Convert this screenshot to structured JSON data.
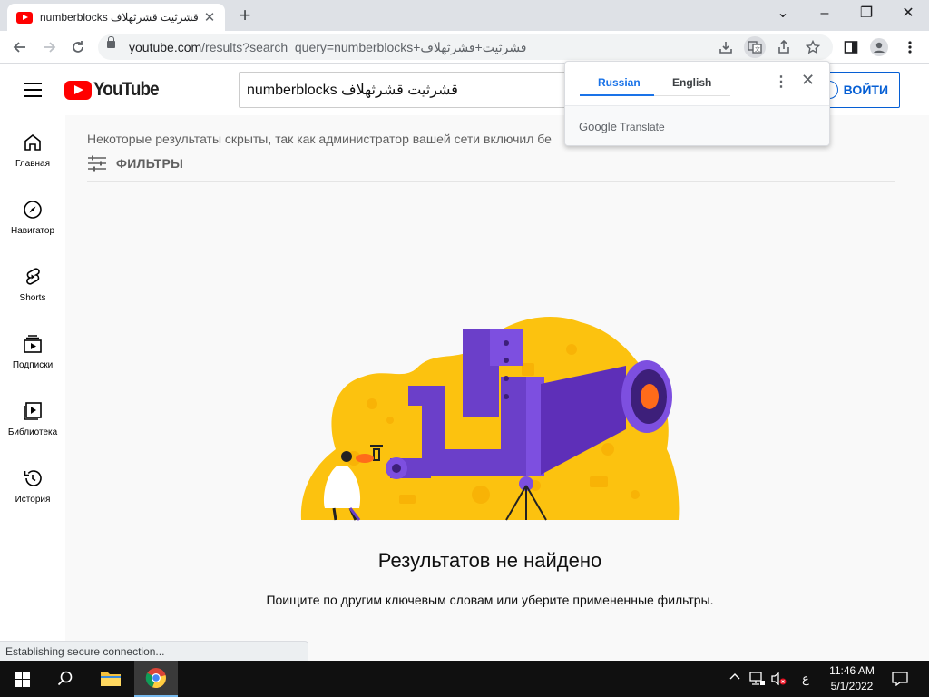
{
  "browser": {
    "tab": {
      "title": "numberblocks قشرثيت قشرثهلاف",
      "close_icon": "✕"
    },
    "new_tab": "+",
    "window_controls": {
      "menu": "⌄",
      "minimize": "–",
      "restore": "❐",
      "close": "✕"
    },
    "url_host": "youtube.com",
    "url_path": "/results?search_query=numberblocks+قشرثيت+قشرثهلاف"
  },
  "youtube": {
    "logo_text": "YouTube",
    "search_value": "numberblocks قشرثيت قشرثهلاف",
    "signin_label": "ВОЙТИ",
    "sidebar": [
      {
        "label": "Главная",
        "icon": "home-icon"
      },
      {
        "label": "Навигатор",
        "icon": "compass-icon"
      },
      {
        "label": "Shorts",
        "icon": "shorts-icon"
      },
      {
        "label": "Подписки",
        "icon": "subscriptions-icon"
      },
      {
        "label": "Библиотека",
        "icon": "library-icon"
      },
      {
        "label": "История",
        "icon": "history-icon"
      }
    ],
    "notice": "Некоторые результаты скрыты, так как администратор вашей сети включил бе",
    "filters_label": "ФИЛЬТРЫ",
    "no_results_title": "Результатов не найдено",
    "no_results_hint": "Поищите по другим ключевым словам или уберите примененные фильтры."
  },
  "translate_popup": {
    "tabs": [
      "Russian",
      "English"
    ],
    "active_tab": "Russian",
    "brand": "Google",
    "brand_suffix": "Translate"
  },
  "status_text": "Establishing secure connection...",
  "taskbar": {
    "time": "11:46 AM",
    "date": "5/1/2022",
    "input_lang": "ع"
  },
  "colors": {
    "youtube_red": "#ff0000",
    "link_blue": "#065fd4",
    "translate_blue": "#1a73e8",
    "illustration_yellow": "#fcc20f",
    "illustration_purple": "#6b3fc9"
  }
}
